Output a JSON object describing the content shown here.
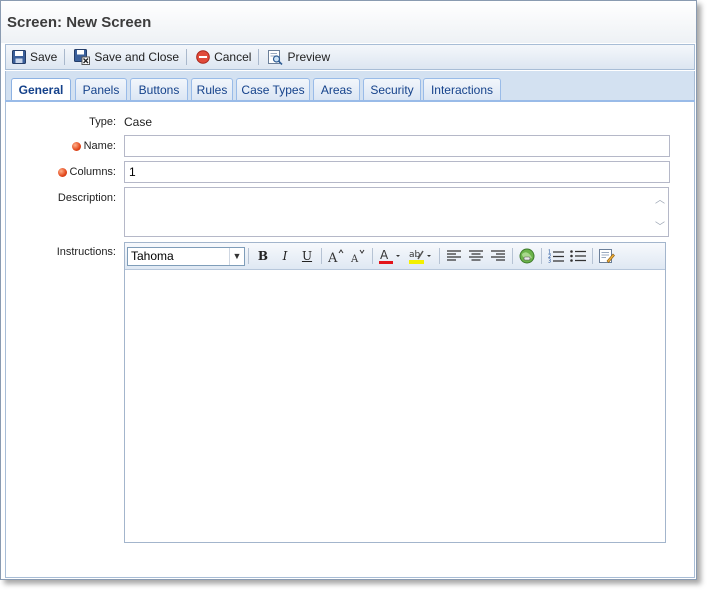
{
  "window": {
    "title": "Screen: New Screen"
  },
  "toolbar": {
    "save_label": "Save",
    "save_close_label": "Save and Close",
    "cancel_label": "Cancel",
    "preview_label": "Preview"
  },
  "tabs": [
    {
      "label": "General",
      "active": true
    },
    {
      "label": "Panels"
    },
    {
      "label": "Buttons"
    },
    {
      "label": "Rules"
    },
    {
      "label": "Case Types"
    },
    {
      "label": "Areas"
    },
    {
      "label": "Security"
    },
    {
      "label": "Interactions"
    }
  ],
  "form": {
    "type_label": "Type:",
    "type_value": "Case",
    "name_label": "Name:",
    "name_value": "",
    "columns_label": "Columns:",
    "columns_value": "1",
    "description_label": "Description:",
    "description_value": "",
    "instructions_label": "Instructions:"
  },
  "editor": {
    "font_value": "Tahoma",
    "body_text": ""
  },
  "colors": {
    "tab_text": "#15428b",
    "required_dot": "#e2461a",
    "toolbar_bg": "#dde6f1"
  }
}
